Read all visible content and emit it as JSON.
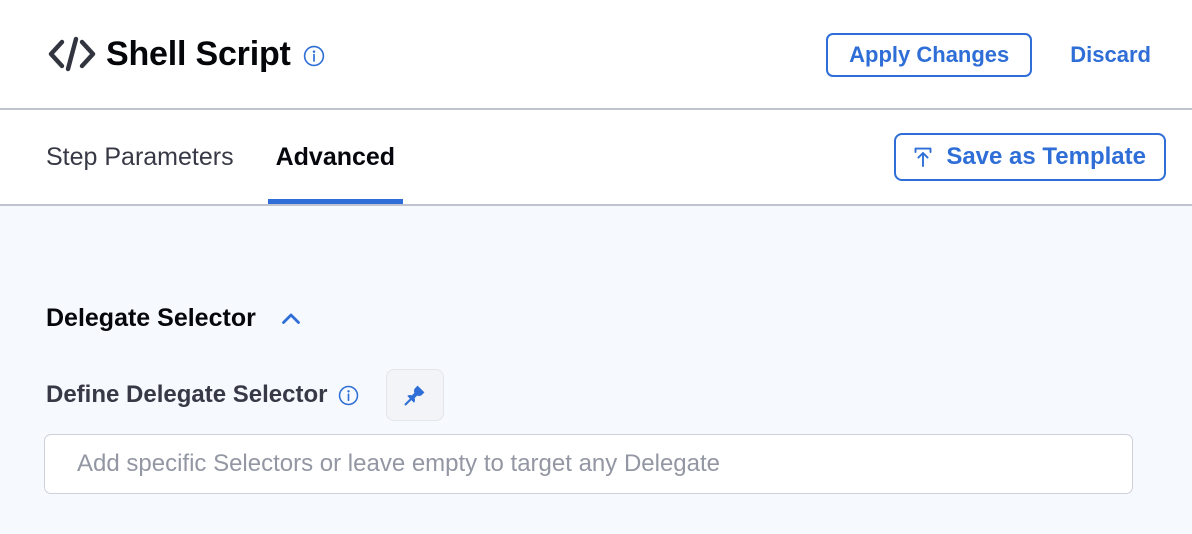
{
  "header": {
    "code_icon": "code-brackets-icon",
    "title": "Shell Script",
    "info_icon": "info-icon",
    "apply_label": "Apply Changes",
    "discard_label": "Discard"
  },
  "tabs": {
    "items": [
      {
        "label": "Step Parameters",
        "active": false
      },
      {
        "label": "Advanced",
        "active": true
      }
    ],
    "save_template_label": "Save as Template",
    "save_template_icon": "save-to-template-arrow-icon"
  },
  "content": {
    "section": {
      "title": "Delegate Selector",
      "collapse_icon": "chevron-up-icon"
    },
    "field": {
      "label": "Define Delegate Selector",
      "info_icon": "info-icon",
      "pin_icon": "pushpin-icon",
      "pin_active": true
    },
    "selector_input": {
      "value": "",
      "placeholder": "Add specific Selectors or leave empty to target any Delegate"
    }
  },
  "colors": {
    "accent_blue": "#2e6ed6",
    "content_background": "#f6f9fd",
    "border_gray": "#bfc4cf",
    "text_dark": "#06070c",
    "text_muted": "#383946",
    "placeholder_gray": "#9397a3"
  }
}
